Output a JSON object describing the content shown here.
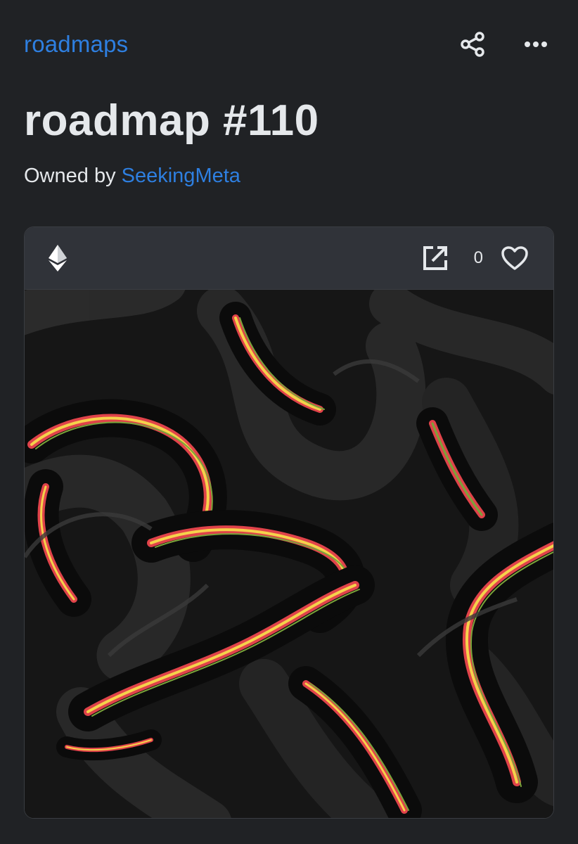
{
  "header": {
    "collection_name": "roadmaps",
    "share_icon": "share-icon",
    "more_icon": "more-horizontal-icon"
  },
  "item": {
    "title": "roadmap #110",
    "owner_prefix": "Owned by",
    "owner_name": "SeekingMeta"
  },
  "card": {
    "chain_icon": "ethereum-icon",
    "external_link_icon": "open-external-icon",
    "like_count": "0",
    "like_icon": "heart-outline-icon"
  },
  "colors": {
    "background": "#202225",
    "card_header": "#303339",
    "link": "#2e7fe0",
    "text": "#e5e8eb",
    "artwork_bg": "#111111",
    "artwork_stripes": [
      "#e0434a",
      "#f5d24b",
      "#7aa43a"
    ]
  }
}
